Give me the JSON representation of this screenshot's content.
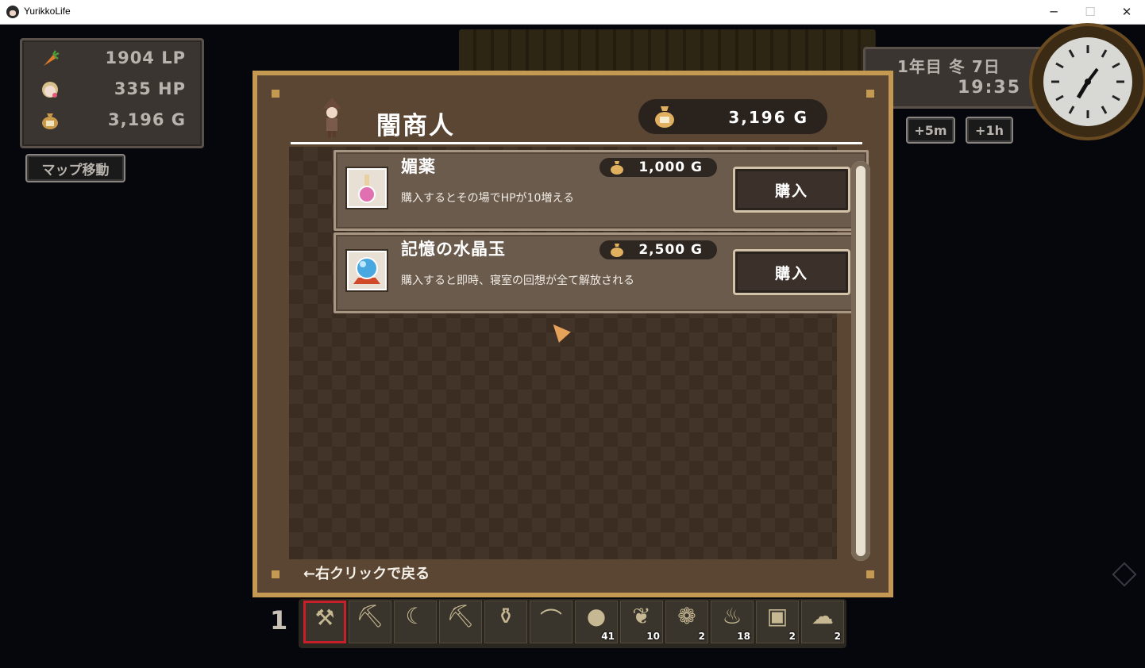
{
  "window": {
    "title": "YurikkoLife",
    "minimize": "─",
    "maximize": "☐",
    "close": "✕"
  },
  "hud": {
    "stats": [
      {
        "icon": "carrot-icon",
        "value": "1904 LP"
      },
      {
        "icon": "character-face-icon",
        "value": "335 HP"
      },
      {
        "icon": "gold-bag-icon",
        "value": "3,196 G"
      }
    ],
    "map_button": "マップ移動",
    "date": "1年目 冬 7日",
    "time": "19:35",
    "time_buttons": [
      "+5m",
      "+1h"
    ]
  },
  "shop": {
    "title": "闇商人",
    "gold": "3,196 G",
    "back_hint": "←右クリックで戻る",
    "items": [
      {
        "name": "媚薬",
        "price": "1,000 G",
        "description": "購入するとその場でHPが10増える",
        "buy_label": "購入",
        "icon": "potion-icon"
      },
      {
        "name": "記憶の水晶玉",
        "price": "2,500 G",
        "description": "購入すると即時、寝室の回想が全て解放される",
        "buy_label": "購入",
        "icon": "crystal-ball-icon"
      }
    ]
  },
  "hotbar": {
    "page": "1",
    "slots": [
      {
        "icon": "hammer-icon",
        "glyph": "⚒",
        "count": "",
        "selected": true
      },
      {
        "icon": "pickaxe-icon",
        "glyph": "⛏",
        "count": ""
      },
      {
        "icon": "sickle-icon",
        "glyph": "☾",
        "count": ""
      },
      {
        "icon": "hoe-icon",
        "glyph": "⛏",
        "count": ""
      },
      {
        "icon": "watering-can-icon",
        "glyph": "⚱",
        "count": ""
      },
      {
        "icon": "fishing-rod-icon",
        "glyph": "⌒",
        "count": ""
      },
      {
        "icon": "coal-icon",
        "glyph": "●",
        "count": "41"
      },
      {
        "icon": "edamame-icon",
        "glyph": "❦",
        "count": "10"
      },
      {
        "icon": "vine-icon",
        "glyph": "❁",
        "count": "2"
      },
      {
        "icon": "chili-pepper-icon",
        "glyph": "♨",
        "count": "18"
      },
      {
        "icon": "milk-carton-icon",
        "glyph": "▣",
        "count": "2"
      },
      {
        "icon": "rice-icon",
        "glyph": "☁",
        "count": "2"
      }
    ]
  },
  "colors": {
    "panel_frame": "#c49a52",
    "panel_bg": "#3b2d21",
    "selected_slot": "#c8202a"
  }
}
